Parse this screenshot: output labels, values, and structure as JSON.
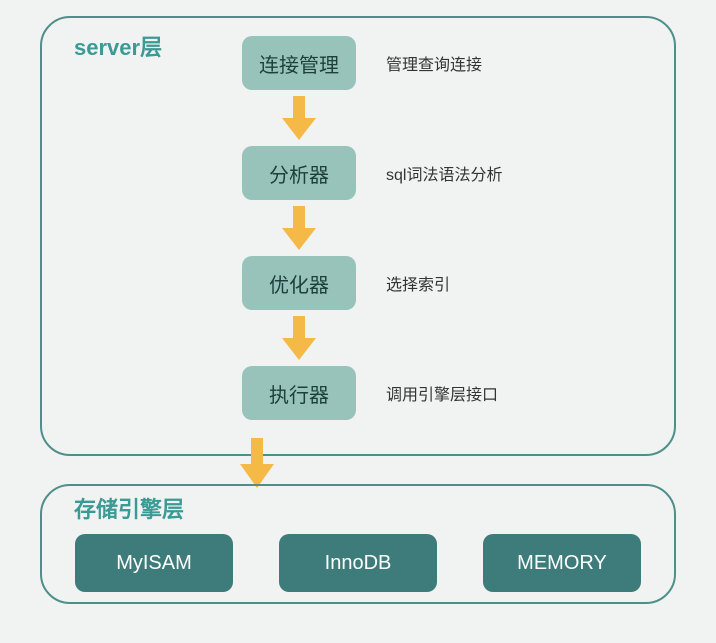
{
  "server_layer": {
    "title": "server层",
    "stages": [
      {
        "name": "连接管理",
        "desc": "管理查询连接"
      },
      {
        "name": "分析器",
        "desc": "sql词法语法分析"
      },
      {
        "name": "优化器",
        "desc": "选择索引"
      },
      {
        "name": "执行器",
        "desc": "调用引擎层接口"
      }
    ]
  },
  "storage_layer": {
    "title": "存储引擎层",
    "engines": [
      "MyISAM",
      "InnoDB",
      "MEMORY"
    ]
  },
  "colors": {
    "border": "#4f8f8a",
    "stage_bg": "#98c3bb",
    "engine_bg": "#3d7c7a",
    "arrow": "#f5b947"
  }
}
